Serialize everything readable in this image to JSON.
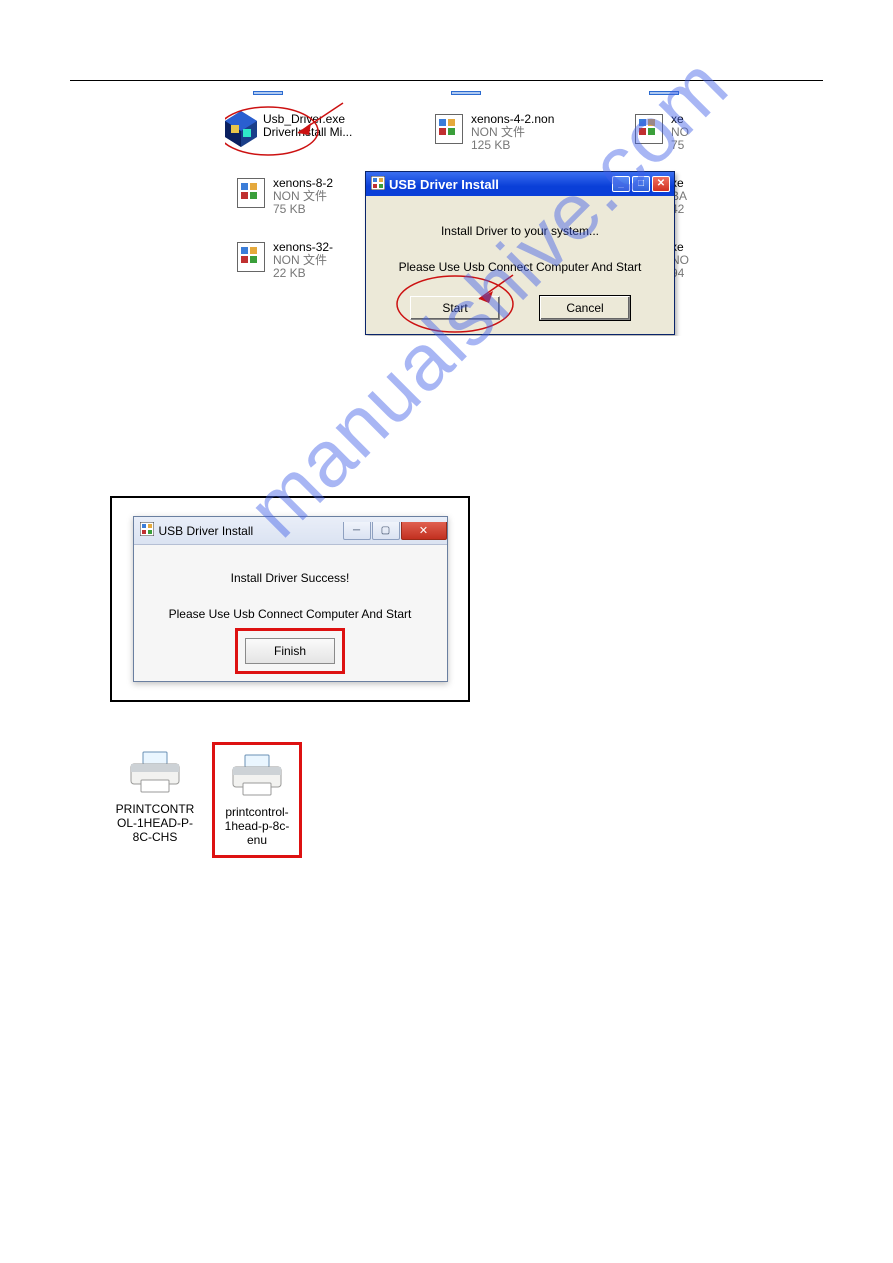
{
  "watermark": "manualshive.com",
  "explorer": {
    "files": [
      {
        "name": "Usb_Driver.exe",
        "desc": "DriverInstall Mi..."
      },
      {
        "name": "xenons-4-2.non",
        "type": "NON 文件",
        "size": "125 KB"
      },
      {
        "name": "xe",
        "type": "NO",
        "size": "75"
      },
      {
        "name": "xenons-8-2",
        "type": "NON 文件",
        "size": "75 KB"
      },
      {
        "name": "xe",
        "type": "BA",
        "size": "42"
      },
      {
        "name": "xenons-32-",
        "type": "NON 文件",
        "size": "22 KB"
      },
      {
        "name": "xe",
        "type": "NO",
        "size": "94"
      }
    ]
  },
  "xp_dialog": {
    "title": "USB Driver Install",
    "line1": "Install Driver to your system...",
    "line2": "Please Use Usb Connect Computer And Start",
    "start": "Start",
    "cancel": "Cancel"
  },
  "w7_dialog": {
    "title": "USB Driver Install",
    "line1": "Install Driver Success!",
    "line2": "Please Use Usb Connect Computer And Start",
    "finish": "Finish"
  },
  "desktop": {
    "icon1": "PRINTCONTROL-1HEAD-P-8C-CHS",
    "icon2": "printcontrol-1head-p-8c-enu"
  }
}
